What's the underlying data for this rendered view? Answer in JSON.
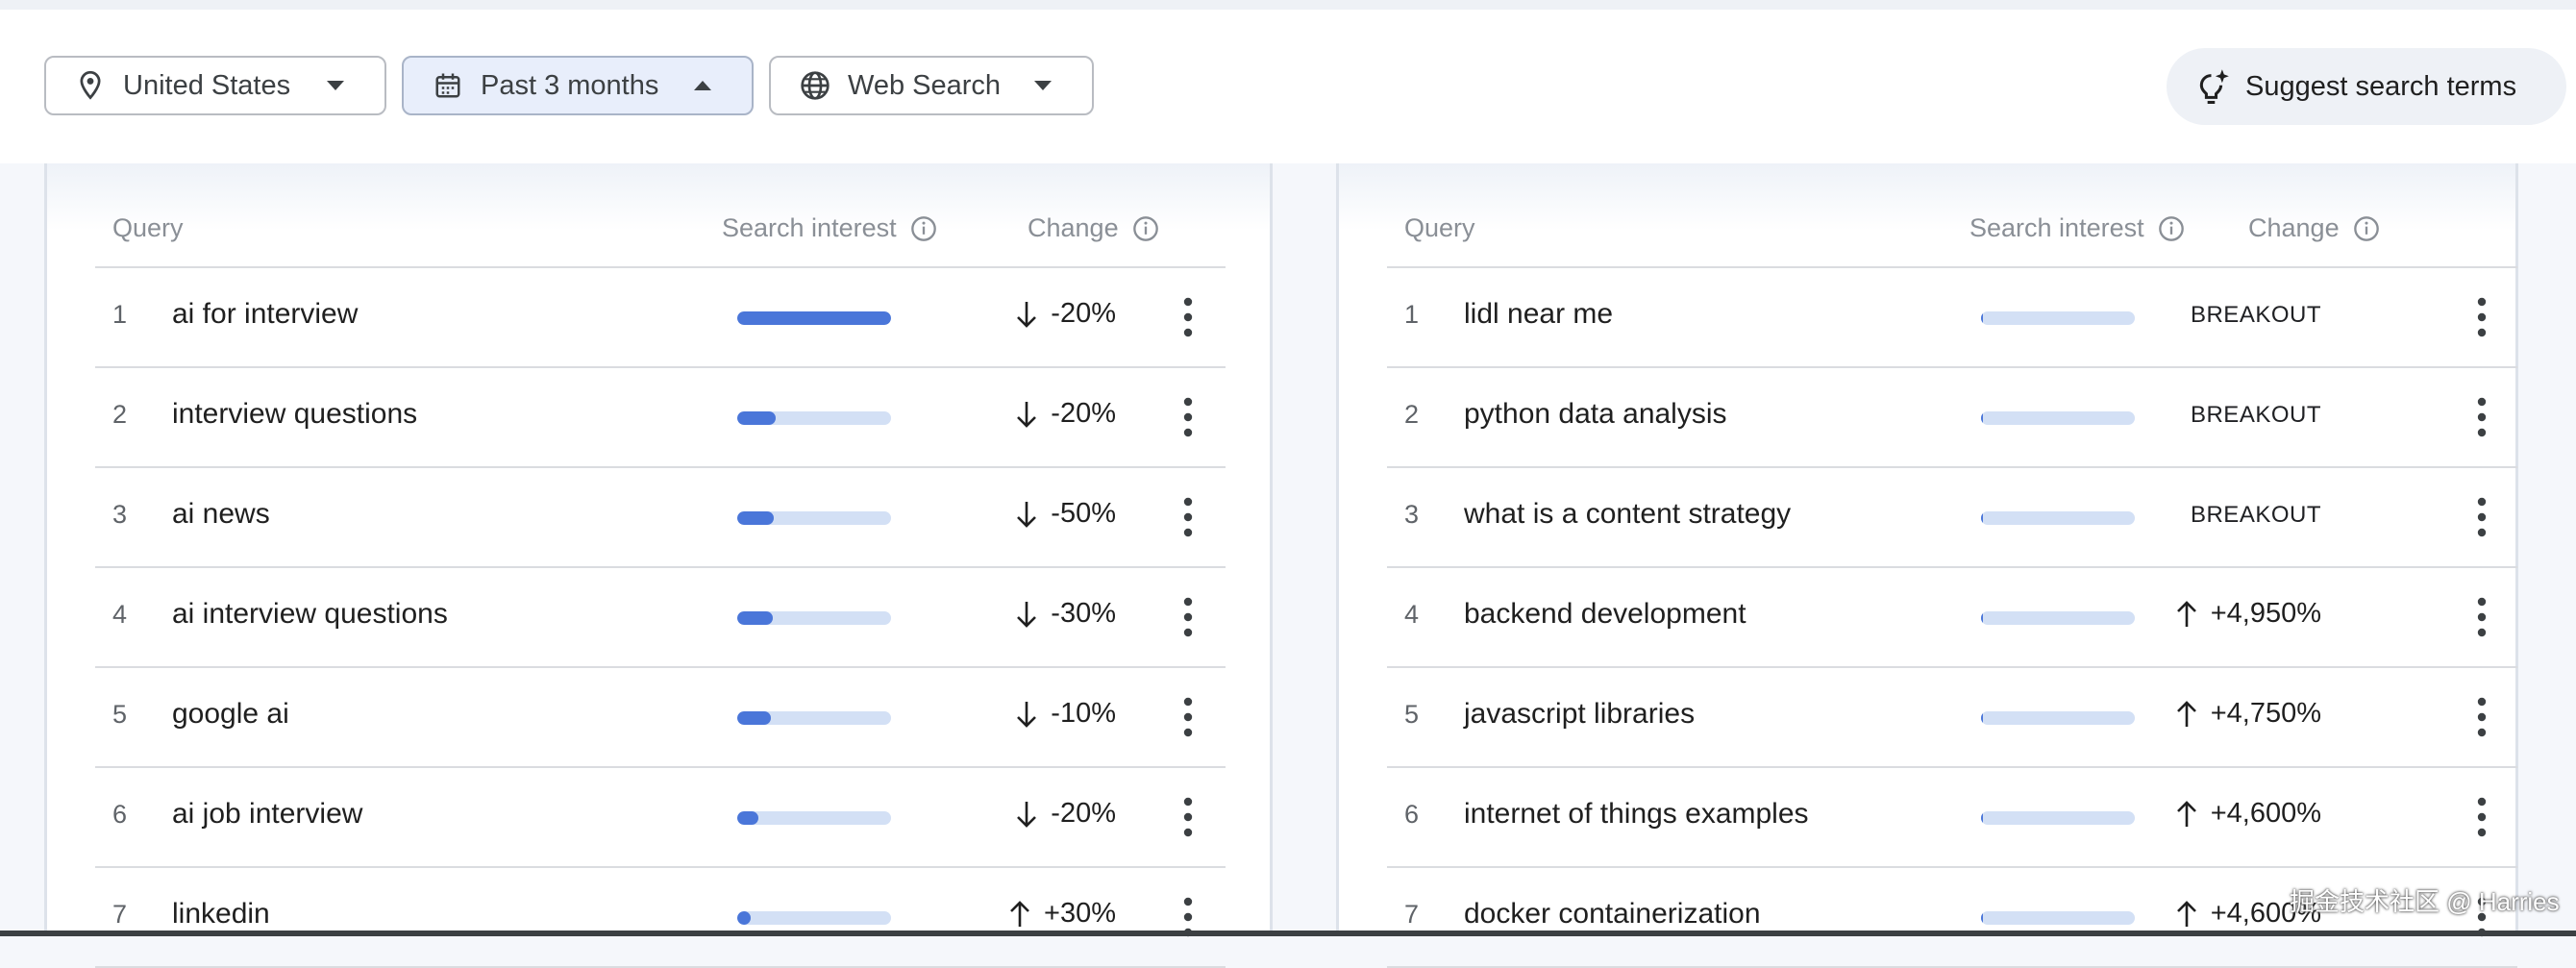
{
  "filters": {
    "location": "United States",
    "time_range": "Past 3 months",
    "search_type": "Web Search"
  },
  "suggest_label": "Suggest search terms",
  "columns": {
    "query": "Query",
    "interest": "Search interest",
    "change": "Change"
  },
  "left_table": [
    {
      "rank": "1",
      "query": "ai for interview",
      "interest": 1.0,
      "direction": "down",
      "change": "-20%"
    },
    {
      "rank": "2",
      "query": "interview questions",
      "interest": 0.25,
      "direction": "down",
      "change": "-20%"
    },
    {
      "rank": "3",
      "query": "ai news",
      "interest": 0.24,
      "direction": "down",
      "change": "-50%"
    },
    {
      "rank": "4",
      "query": "ai interview questions",
      "interest": 0.23,
      "direction": "down",
      "change": "-30%"
    },
    {
      "rank": "5",
      "query": "google ai",
      "interest": 0.22,
      "direction": "down",
      "change": "-10%"
    },
    {
      "rank": "6",
      "query": "ai job interview",
      "interest": 0.14,
      "direction": "down",
      "change": "-20%"
    },
    {
      "rank": "7",
      "query": "linkedin",
      "interest": 0.09,
      "direction": "up",
      "change": "+30%"
    }
  ],
  "right_table": [
    {
      "rank": "1",
      "query": "lidl near me",
      "interest": 0.01,
      "direction": "none",
      "change": "BREAKOUT"
    },
    {
      "rank": "2",
      "query": "python data analysis",
      "interest": 0.01,
      "direction": "none",
      "change": "BREAKOUT"
    },
    {
      "rank": "3",
      "query": "what is a content strategy",
      "interest": 0.01,
      "direction": "none",
      "change": "BREAKOUT"
    },
    {
      "rank": "4",
      "query": "backend development",
      "interest": 0.01,
      "direction": "up",
      "change": "+4,950%"
    },
    {
      "rank": "5",
      "query": "javascript libraries",
      "interest": 0.01,
      "direction": "up",
      "change": "+4,750%"
    },
    {
      "rank": "6",
      "query": "internet of things examples",
      "interest": 0.01,
      "direction": "up",
      "change": "+4,600%"
    },
    {
      "rank": "7",
      "query": "docker containerization",
      "interest": 0.01,
      "direction": "up",
      "change": "+4,600%"
    }
  ],
  "watermark": "掘金技术社区 @ Harries",
  "colors": {
    "bar_fill": "#4a76d9",
    "bar_track": "#d3e0f5",
    "active_chip": "#e8eefb"
  }
}
